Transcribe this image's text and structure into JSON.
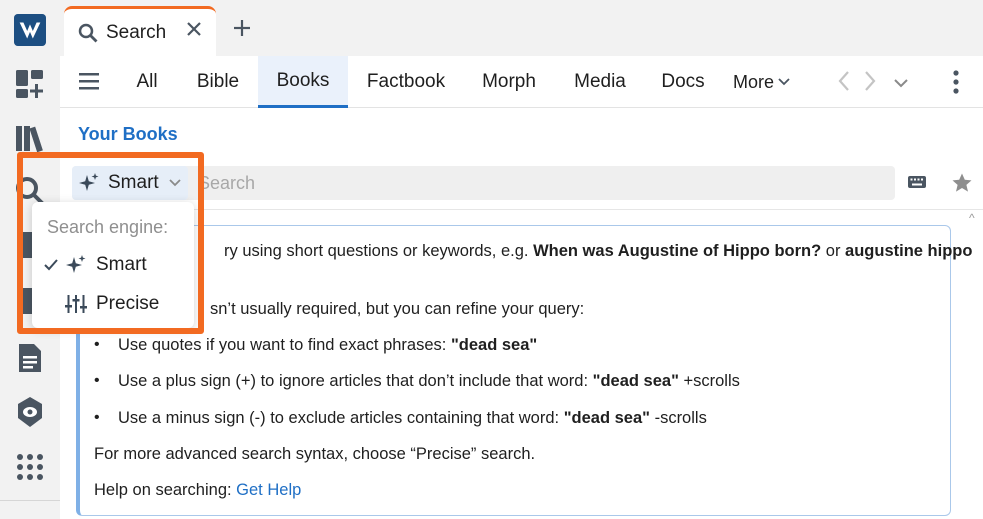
{
  "rail": {
    "icons": [
      "logos-icon",
      "dashboard-add-icon",
      "library-icon",
      "search-icon",
      "guides-icon",
      "layouts-icon",
      "document-icon",
      "eye-shield-icon",
      "apps-grid-icon"
    ]
  },
  "tabs": [
    {
      "label": "Search",
      "icon": "search-icon"
    }
  ],
  "nav": {
    "tabs": [
      "All",
      "Bible",
      "Books",
      "Factbook",
      "Morph",
      "Media",
      "Docs"
    ],
    "active": "Books",
    "more_label": "More"
  },
  "section_title": "Your Books",
  "search": {
    "mode_label": "Smart",
    "placeholder": "Search",
    "value": ""
  },
  "dropdown": {
    "header": "Search engine:",
    "options": [
      {
        "label": "Smart",
        "selected": true,
        "icon": "sparkle-icon"
      },
      {
        "label": "Precise",
        "selected": false,
        "icon": "sliders-icon"
      }
    ]
  },
  "help": {
    "line1_prefix": "Enter your query using short questions or keywords, e.g. ",
    "line1_visible": "ry using short questions or keywords, e.g. ",
    "line1_ex1": "When was Augustine of Hippo born?",
    "line1_or": " or ",
    "line1_ex2": "augustine hippo",
    "line2_visible": "sn’t usually required, but you can refine your query:",
    "bullets": [
      {
        "text": "Use quotes if you want to find exact phrases: ",
        "bold": "\"dead sea\"",
        "tail": ""
      },
      {
        "text": "Use a plus sign (+) to ignore articles that don’t include that word: ",
        "bold": "\"dead sea\"",
        "tail": " +scrolls"
      },
      {
        "text": "Use a minus sign (-) to exclude articles containing that word: ",
        "bold": "\"dead sea\"",
        "tail": " -scrolls"
      }
    ],
    "advanced": "For more advanced search syntax, choose “Precise” search.",
    "help_prefix": "Help on searching: ",
    "help_link": "Get Help"
  },
  "colors": {
    "accent": "#1f6fc5",
    "highlight": "#f26a21",
    "brand": "#1d4f82"
  }
}
